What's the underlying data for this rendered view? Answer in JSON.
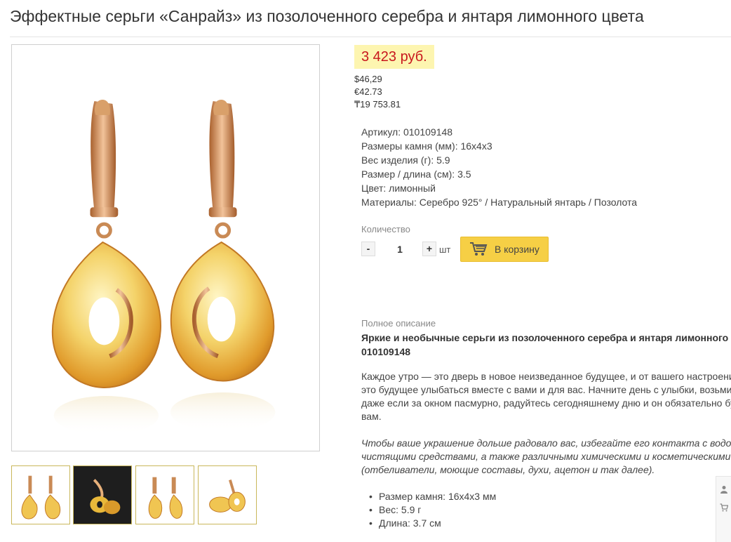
{
  "product": {
    "title": "Эффектные серьги «Санрайз» из позолоченного серебра и янтаря лимонного цвета"
  },
  "price": {
    "main": "3 423 руб.",
    "usd": "$46,29",
    "eur": "€42.73",
    "kzt": "₸19 753.81",
    "accent_color": "#c8171e",
    "badge_color": "#fdf5b0"
  },
  "specs": [
    "Артикул: 010109148",
    "Размеры камня (мм): 16х4х3",
    "Вес изделия (г): 5.9",
    "Размер / длина (см): 3.5",
    "Цвет: лимонный",
    "Материалы: Серебро 925° / Натуральный янтарь / Позолота"
  ],
  "quantity": {
    "label": "Количество",
    "minus": "-",
    "value": "1",
    "plus": "+",
    "unit": "шт"
  },
  "cart": {
    "label": "В корзину",
    "icon": "shopping-cart-icon",
    "color": "#f6cf45"
  },
  "description": {
    "label": "Полное описание",
    "heading_line1": "Яркие и необычные серьги из позолоченного серебра и янтаря лимонного",
    "heading_line2": "010109148",
    "paragraph1": [
      "Каждое утро — это дверь в новое неизведанное будущее, и от вашего настроени",
      "это будущее улыбаться вместе с вами и для вас. Начните день с улыбки, возьми",
      "даже если за окном пасмурно, радуйтесь сегодняшнему дню и он обязательно бу",
      "вам."
    ],
    "paragraph2": [
      "Чтобы ваше украшение дольше радовало вас, избегайте его контакта с водо",
      "чистящими средствами, а также различными химическими и косметическими",
      "(отбеливатели, моющие составы, духи, ацетон и так далее)."
    ],
    "bullets": [
      "Размер камня: 16х4х3 мм",
      "Вес: 5.9 г",
      "Длина: 3.7 см"
    ]
  },
  "side_panel": {
    "icons": [
      "user-icon",
      "cart-icon"
    ]
  }
}
